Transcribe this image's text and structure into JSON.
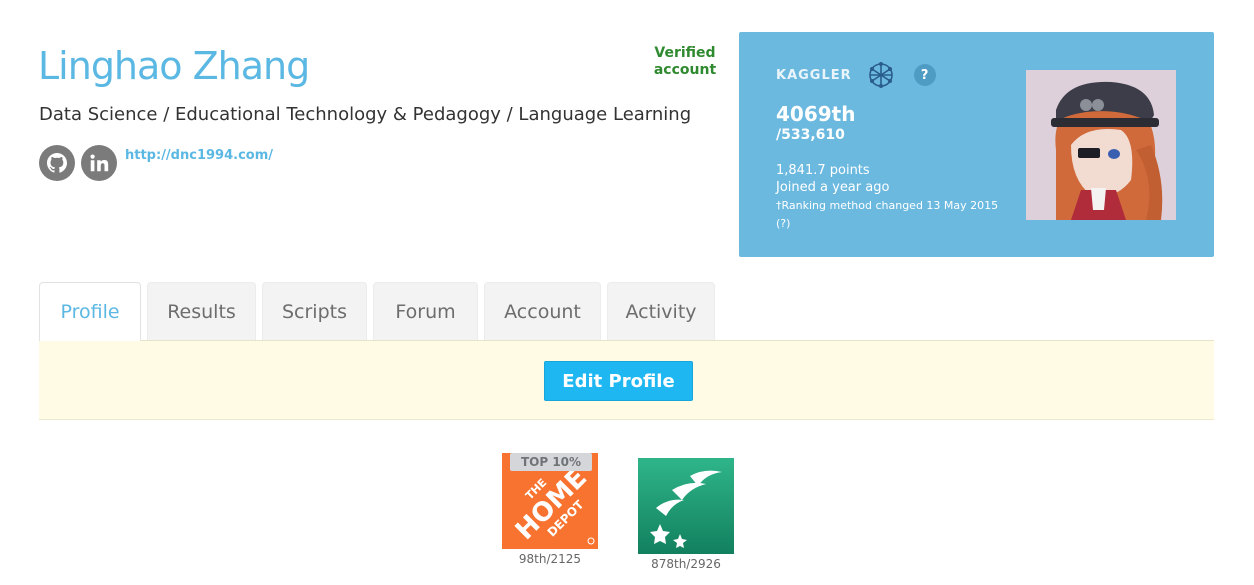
{
  "profile": {
    "name": "Linghao Zhang",
    "tagline": "Data Science / Educational Technology & Pedagogy / Language Learning",
    "verified_label": "Verified account",
    "website": "http://dnc1994.com/",
    "social_icons": [
      "github-icon",
      "linkedin-icon"
    ]
  },
  "card": {
    "kaggler_label": "KAGGLER",
    "help": "?",
    "rank": "4069th",
    "total": "/533,610",
    "points": "1,841.7 points",
    "joined": "Joined a year ago",
    "ranking_note": "†Ranking method changed 13 May 2015",
    "ranking_note_link": "(?)",
    "background_color": "#6cb9e0"
  },
  "tabs": [
    {
      "label": "Profile",
      "active": true
    },
    {
      "label": "Results",
      "active": false
    },
    {
      "label": "Scripts",
      "active": false
    },
    {
      "label": "Forum",
      "active": false
    },
    {
      "label": "Account",
      "active": false
    },
    {
      "label": "Activity",
      "active": false
    }
  ],
  "edit_profile_label": "Edit Profile",
  "competitions": [
    {
      "badge": "TOP 10%",
      "logo_text": "THE HOME DEPOT",
      "result": "98th/2125",
      "logo_color": "#f7732f"
    },
    {
      "badge": "",
      "logo_text": "",
      "result": "878th/2926",
      "logo_color": "#1d9b74"
    }
  ],
  "colors": {
    "accent": "#5bb8e3",
    "verified": "#2f8a2f",
    "edit_button": "#1fb7f2",
    "edit_bar": "#fffbe5"
  }
}
